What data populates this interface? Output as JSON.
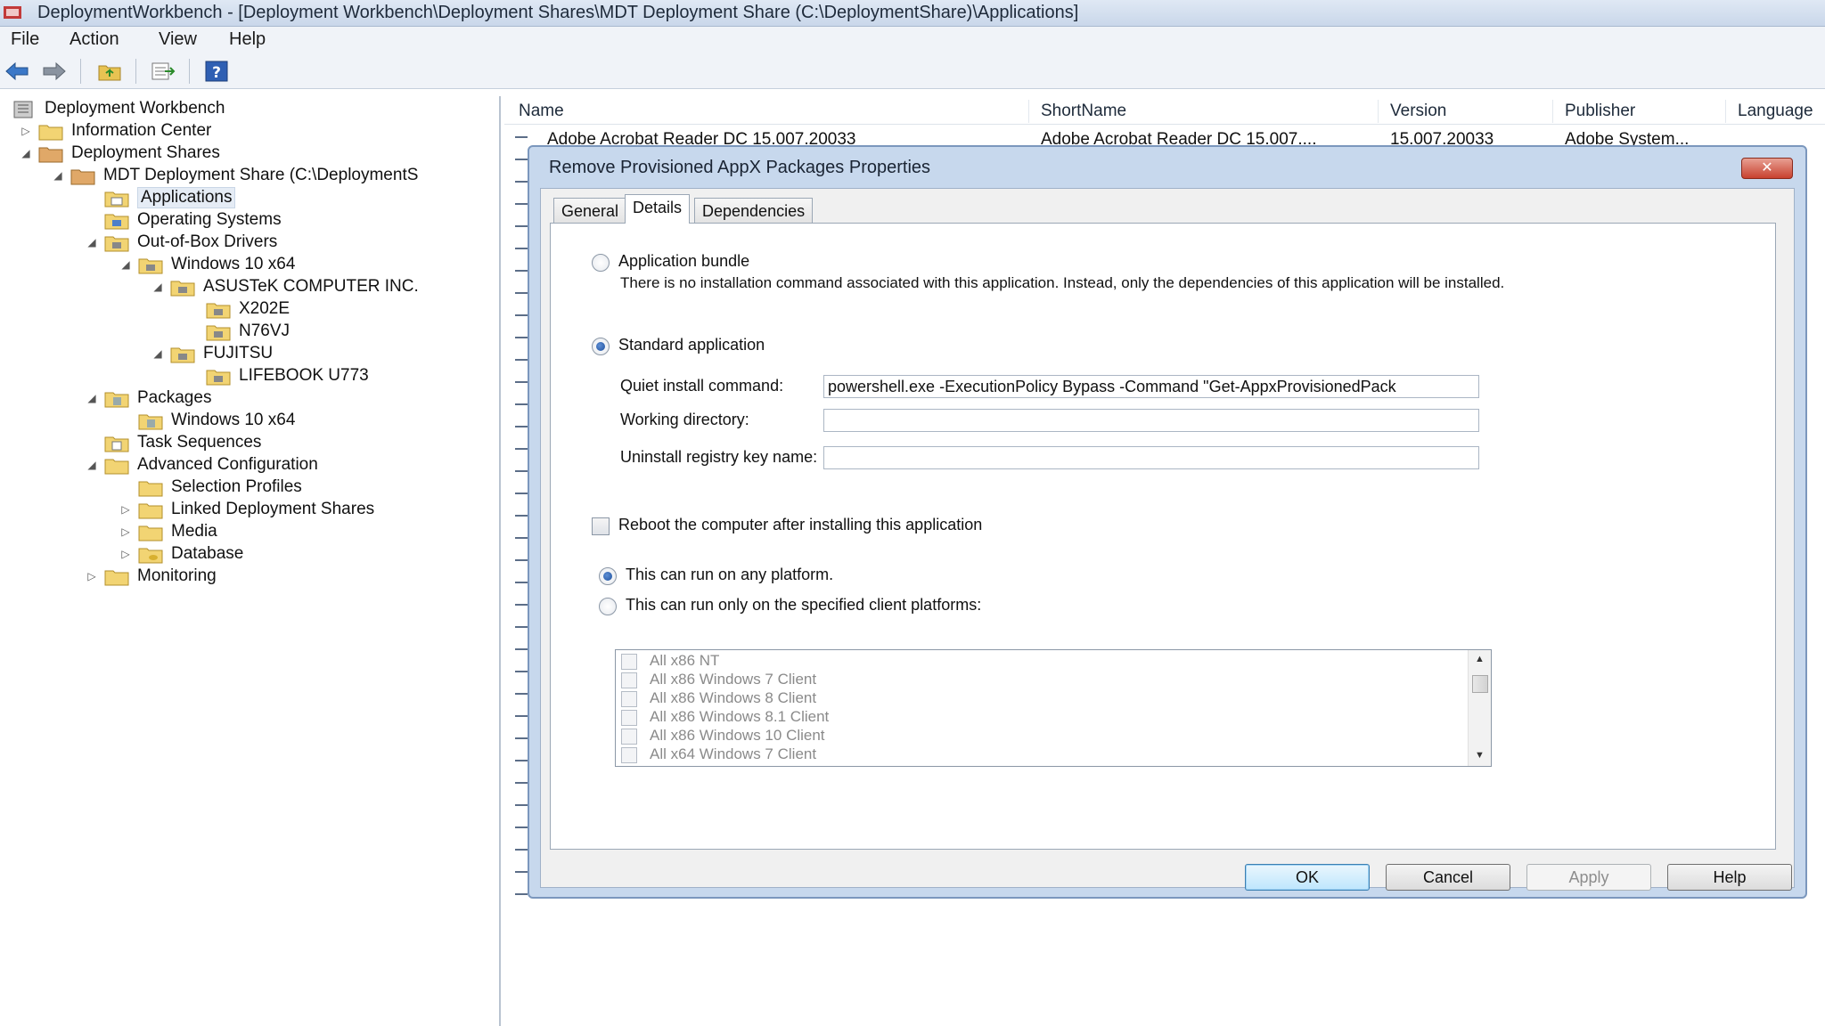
{
  "window": {
    "title": "DeploymentWorkbench - [Deployment Workbench\\Deployment Shares\\MDT Deployment Share (C:\\DeploymentShare)\\Applications]"
  },
  "menu": [
    "File",
    "Action",
    "View",
    "Help"
  ],
  "tree": {
    "items": [
      {
        "label": "Deployment Workbench"
      },
      {
        "label": "Information Center"
      },
      {
        "label": "Deployment Shares"
      },
      {
        "label": "MDT Deployment Share (C:\\DeploymentS"
      },
      {
        "label": "Applications"
      },
      {
        "label": "Operating Systems"
      },
      {
        "label": "Out-of-Box Drivers"
      },
      {
        "label": "Windows 10 x64"
      },
      {
        "label": "ASUSTeK COMPUTER INC."
      },
      {
        "label": "X202E"
      },
      {
        "label": "N76VJ"
      },
      {
        "label": "FUJITSU"
      },
      {
        "label": "LIFEBOOK U773"
      },
      {
        "label": "Packages"
      },
      {
        "label": "Windows 10 x64"
      },
      {
        "label": "Task Sequences"
      },
      {
        "label": "Advanced Configuration"
      },
      {
        "label": "Selection Profiles"
      },
      {
        "label": "Linked Deployment Shares"
      },
      {
        "label": "Media"
      },
      {
        "label": "Database"
      },
      {
        "label": "Monitoring"
      }
    ]
  },
  "list": {
    "columns": [
      "Name",
      "ShortName",
      "Version",
      "Publisher",
      "Language"
    ],
    "rows": [
      {
        "name": "Adobe Acrobat Reader DC 15.007.20033",
        "shortname": "Adobe Acrobat Reader DC 15.007....",
        "version": "15.007.20033",
        "publisher": "Adobe System..."
      }
    ]
  },
  "dialog": {
    "title": "Remove Provisioned AppX Packages Properties",
    "close_label": "✕",
    "tabs": [
      "General",
      "Details",
      "Dependencies"
    ],
    "active_tab": "Details",
    "bundle_label": "Application bundle",
    "bundle_desc": "There is no installation command associated with this application.  Instead, only the dependencies of this application will be installed.",
    "standard_label": "Standard application",
    "quiet_label": "Quiet install command:",
    "quiet_value": "powershell.exe -ExecutionPolicy Bypass -Command \"Get-AppxProvisionedPack",
    "workdir_label": "Working directory:",
    "workdir_value": "",
    "uninstall_label": "Uninstall registry key name:",
    "uninstall_value": "",
    "reboot_label": "Reboot the computer after installing this application",
    "any_platform_label": "This can run on any platform.",
    "specified_platform_label": "This can run only on the specified client platforms:",
    "platforms": [
      "All x86 NT",
      "All x86 Windows 7 Client",
      "All x86 Windows 8 Client",
      "All x86 Windows 8.1 Client",
      "All x86 Windows 10 Client",
      "All x64 Windows 7 Client"
    ],
    "buttons": {
      "ok": "OK",
      "cancel": "Cancel",
      "apply": "Apply",
      "help": "Help"
    }
  },
  "colors": {
    "accent": "#3c7fb1",
    "dialog_frame": "#c7d8ed",
    "close_red": "#c8412f"
  }
}
